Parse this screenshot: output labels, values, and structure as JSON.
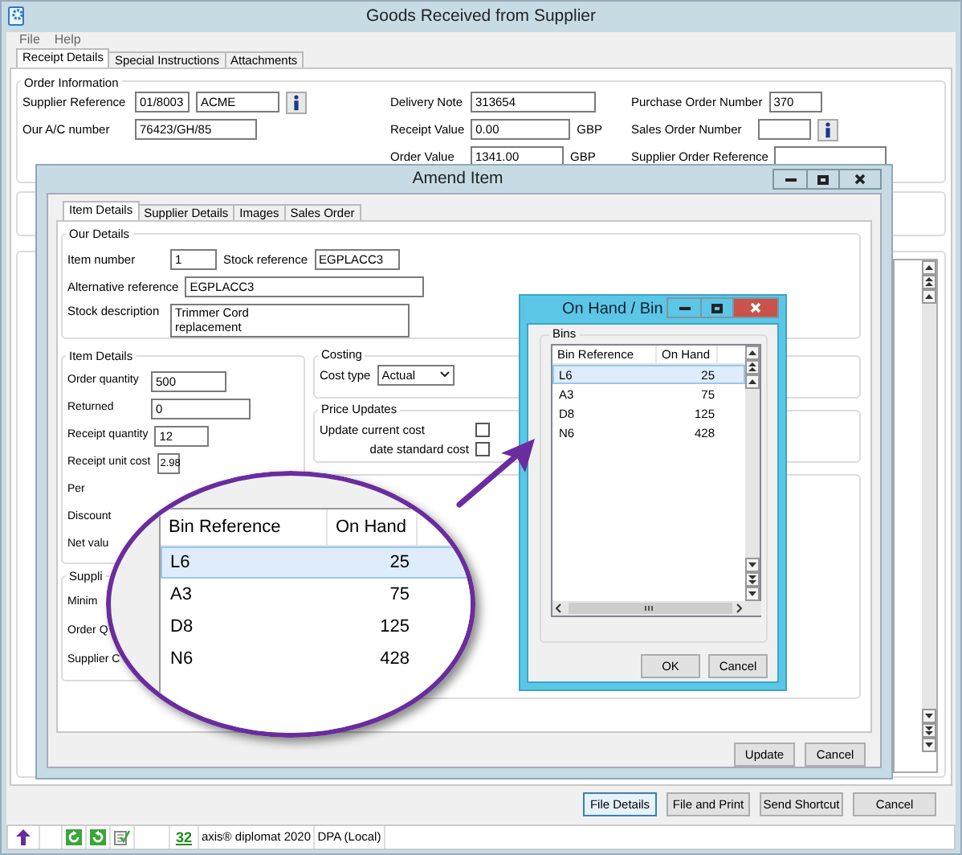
{
  "window": {
    "title": "Goods Received from Supplier"
  },
  "menu": [
    "File",
    "Help"
  ],
  "tabs": [
    {
      "label": "Receipt Details",
      "selected": true
    },
    {
      "label": "Special Instructions",
      "selected": false
    },
    {
      "label": "Attachments",
      "selected": false
    }
  ],
  "order_information": {
    "legend": "Order Information",
    "supplier_reference": {
      "label": "Supplier Reference",
      "code": "01/8003",
      "name": "ACME"
    },
    "account_number": {
      "label": "Our A/C number",
      "value": "76423/GH/85"
    },
    "delivery_note": {
      "label": "Delivery Note",
      "value": "313654"
    },
    "receipt_value": {
      "label": "Receipt Value",
      "value": "0.00",
      "currency": "GBP"
    },
    "order_value": {
      "label": "Order Value",
      "value": "1341.00",
      "currency": "GBP"
    },
    "purchase_order_number": {
      "label": "Purchase Order Number",
      "value": "370"
    },
    "sales_order_number": {
      "label": "Sales Order Number"
    },
    "supplier_order_reference": {
      "label": "Supplier Order Reference"
    }
  },
  "amend_item": {
    "title": "Amend Item",
    "tabs": [
      {
        "label": "Item Details",
        "selected": true
      },
      {
        "label": "Supplier Details",
        "selected": false
      },
      {
        "label": "Images",
        "selected": false
      },
      {
        "label": "Sales Order",
        "selected": false
      }
    ],
    "our_details": {
      "legend": "Our Details",
      "item_number": {
        "label": "Item number",
        "value": "1"
      },
      "stock_reference": {
        "label": "Stock reference",
        "value": "EGPLACC3"
      },
      "alternative_reference": {
        "label": "Alternative reference",
        "value": "EGPLACC3"
      },
      "stock_description": {
        "label": "Stock description",
        "lines": [
          "Trimmer Cord",
          "replacement"
        ]
      }
    },
    "item_details": {
      "legend": "Item Details",
      "fields": [
        {
          "label": "Order quantity",
          "value": "500"
        },
        {
          "label": "Returned",
          "value": "0"
        },
        {
          "label": "Receipt quantity",
          "value": "12"
        },
        {
          "label": "Receipt unit cost",
          "value": "2.98"
        },
        {
          "label": "Per"
        },
        {
          "label": "Discount"
        },
        {
          "label": "Net valu"
        }
      ]
    },
    "supplier": {
      "legend": "Suppli",
      "labels": [
        "Minim",
        "Order Q",
        "Supplier C"
      ]
    },
    "costing": {
      "legend": "Costing",
      "label": "Cost type",
      "value": "Actual"
    },
    "price_updates": {
      "legend": "Price Updates",
      "options": [
        {
          "label": "Update current cost",
          "checked": false
        },
        {
          "label": "date standard cost",
          "checked": false
        }
      ]
    },
    "buttons": [
      "Update",
      "Cancel"
    ]
  },
  "bin_window": {
    "title": "On Hand / Bin",
    "legend": "Bins",
    "columns": [
      "Bin Reference",
      "On Hand"
    ],
    "rows": [
      {
        "bin": "L6",
        "on_hand": "25",
        "selected": true
      },
      {
        "bin": "A3",
        "on_hand": "75",
        "selected": false
      },
      {
        "bin": "D8",
        "on_hand": "125",
        "selected": false
      },
      {
        "bin": "N6",
        "on_hand": "428",
        "selected": false
      }
    ],
    "buttons": [
      "OK",
      "Cancel"
    ]
  },
  "magnifier": {
    "columns": [
      "Bin Reference",
      "On Hand"
    ],
    "rows": [
      {
        "bin": "L6",
        "on_hand": "25",
        "selected": true
      },
      {
        "bin": "A3",
        "on_hand": "75",
        "selected": false
      },
      {
        "bin": "D8",
        "on_hand": "125",
        "selected": false
      },
      {
        "bin": "N6",
        "on_hand": "428",
        "selected": false
      }
    ]
  },
  "buttons": [
    {
      "label": "File Details",
      "default": true
    },
    {
      "label": "File and Print",
      "default": false
    },
    {
      "label": "Send Shortcut",
      "default": false
    },
    {
      "label": "Cancel",
      "default": false
    }
  ],
  "status_bar": {
    "count": "32",
    "product": "axis® diplomat 2020",
    "database": "DPA (Local)"
  }
}
